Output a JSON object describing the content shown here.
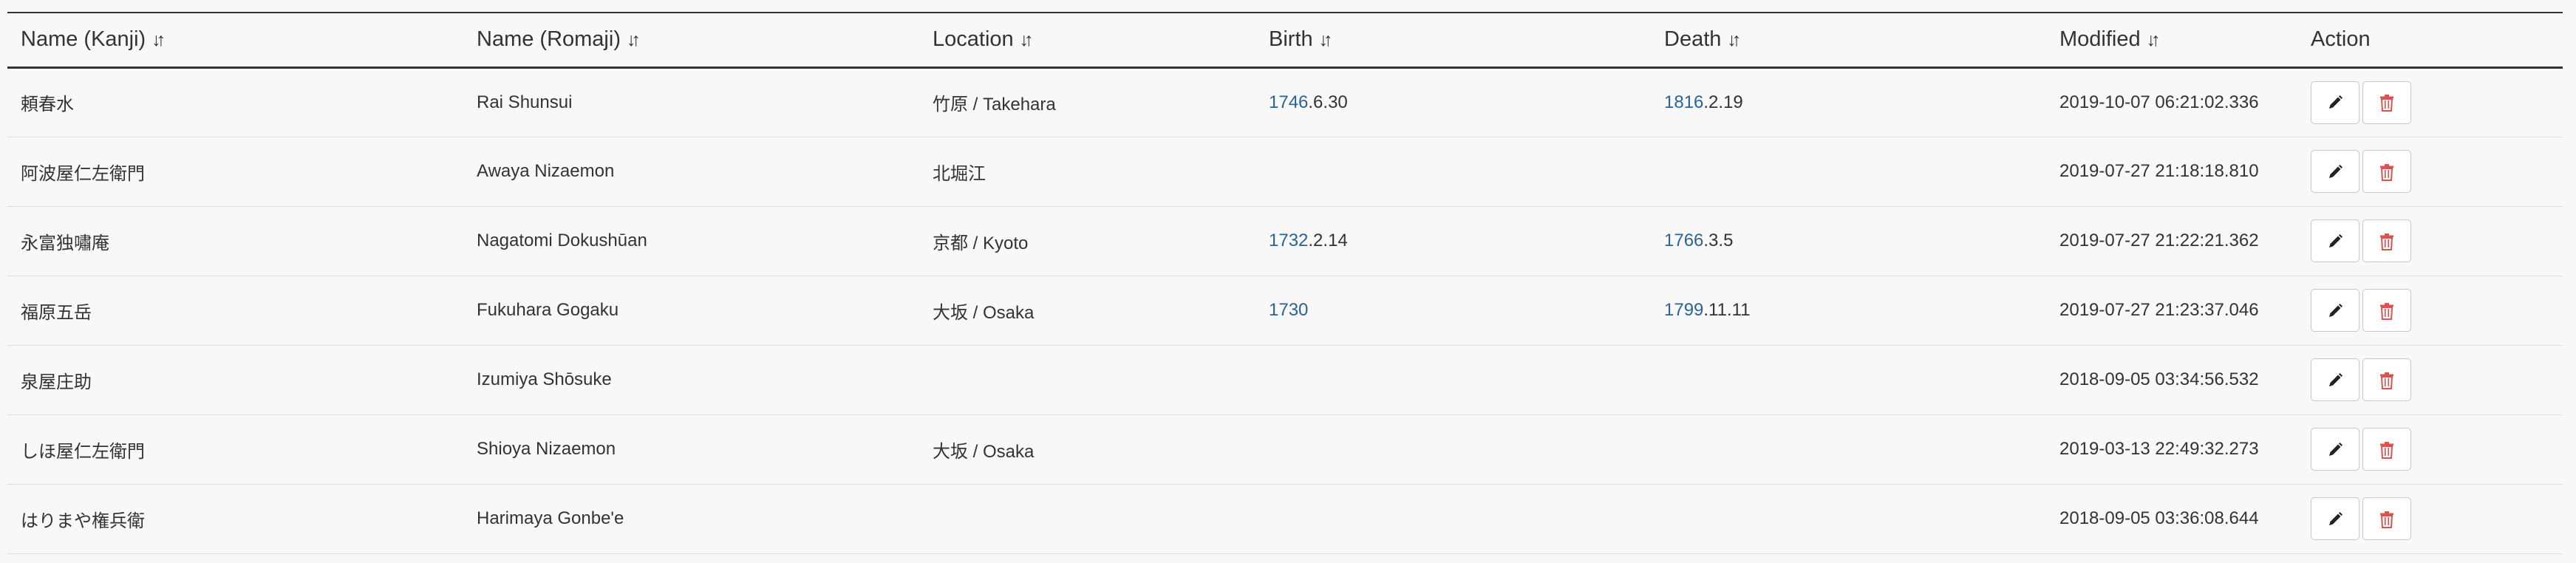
{
  "headers": {
    "kanji": "Name (Kanji)",
    "romaji": "Name (Romaji)",
    "location": "Location",
    "birth": "Birth",
    "death": "Death",
    "modified": "Modified",
    "action": "Action"
  },
  "icons": {
    "sort": "sort-icon",
    "edit": "pencil-icon",
    "delete": "trash-icon"
  },
  "colors": {
    "link": "#2a6496",
    "delete": "#d9534f"
  },
  "rows": [
    {
      "kanji": "頼春水",
      "romaji": "Rai Shunsui",
      "location": "竹原 / Takehara",
      "birth_year": "1746",
      "birth_rest": ".6.30",
      "death_year": "1816",
      "death_rest": ".2.19",
      "modified": "2019-10-07 06:21:02.336"
    },
    {
      "kanji": "阿波屋仁左衛門",
      "romaji": "Awaya Nizaemon",
      "location": "北堀江",
      "birth_year": "",
      "birth_rest": "",
      "death_year": "",
      "death_rest": "",
      "modified": "2019-07-27 21:18:18.810"
    },
    {
      "kanji": "永富独嘯庵",
      "romaji": "Nagatomi Dokushūan",
      "location": "京都 / Kyoto",
      "birth_year": "1732",
      "birth_rest": ".2.14",
      "death_year": "1766",
      "death_rest": ".3.5",
      "modified": "2019-07-27 21:22:21.362"
    },
    {
      "kanji": "福原五岳",
      "romaji": "Fukuhara Gogaku",
      "location": "大坂 / Osaka",
      "birth_year": "1730",
      "birth_rest": "",
      "death_year": "1799",
      "death_rest": ".11.11",
      "modified": "2019-07-27 21:23:37.046"
    },
    {
      "kanji": "泉屋庄助",
      "romaji": "Izumiya Shōsuke",
      "location": "",
      "birth_year": "",
      "birth_rest": "",
      "death_year": "",
      "death_rest": "",
      "modified": "2018-09-05 03:34:56.532"
    },
    {
      "kanji": "しほ屋仁左衛門",
      "romaji": "Shioya Nizaemon",
      "location": "大坂 / Osaka",
      "birth_year": "",
      "birth_rest": "",
      "death_year": "",
      "death_rest": "",
      "modified": "2019-03-13 22:49:32.273"
    },
    {
      "kanji": "はりまや権兵衛",
      "romaji": "Harimaya Gonbe'e",
      "location": "",
      "birth_year": "",
      "birth_rest": "",
      "death_year": "",
      "death_rest": "",
      "modified": "2018-09-05 03:36:08.644"
    }
  ]
}
